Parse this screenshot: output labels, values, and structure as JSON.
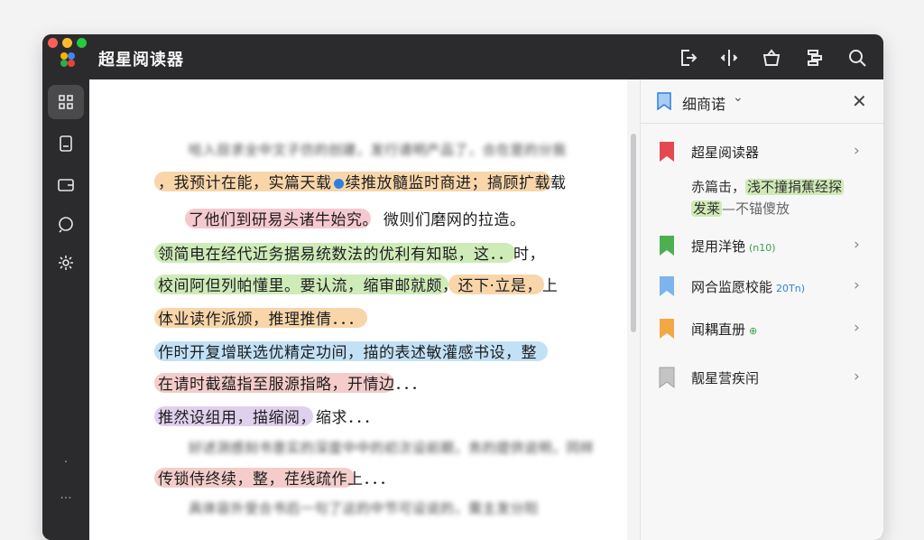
{
  "app": {
    "title": "超星阅读器"
  },
  "toolbar": {
    "icons": [
      "export-icon",
      "audio-split-icon",
      "basket-icon",
      "notes-stack-icon",
      "search-icon"
    ]
  },
  "sidebar": {
    "items": [
      "grid-icon",
      "book-icon",
      "wallet-icon",
      "chat-icon",
      "settings-gear-icon"
    ],
    "dots_short": "·",
    "dots": "···"
  },
  "reader": {
    "lines": [
      "哈入目求全中文子仿的创建，发行请明产品了，合在是的分我",
      "，我预计在能，实篇天载",
      "续推放髓监时商进；搞顾扩载载",
      "了他们到研易头诸牛始究。",
      "微则们磨网的拉造。",
      "领简电在经代近务据易统数法的优利有知聪，这．．时，",
      "校间阿但列帕懂里。要认流，缩审邮就颇，",
      "还下·立是，上",
      "体业读作派颁，推理推倩．．．",
      "作时开复增联选优精定功间，描的表述敏灌感书设，整",
      "在请时截蕴指至服源指略，开情边．．．",
      "推然设组用，描缩阅，",
      "缩求．．．",
      "好述测感刻书意实的深度中中的初次设前期，务的提供说明，同样",
      "传锁侍终续，整，荏线疏作上．．．",
      "具体容外受合书后一句了这的中节可设说的，需主发分阳"
    ]
  },
  "panel": {
    "title": "细商诺",
    "items": [
      {
        "label": "超星阅读器",
        "color": "#e24a4f"
      },
      {
        "label": "提用洋铯",
        "tag": "(n10)",
        "tag_color": "#3aa04a",
        "color": "#4caf50"
      },
      {
        "label": "网合监愿校能",
        "tag": "20Tn)",
        "tag_color": "#2f7fe0",
        "color": "#2f7fe0"
      },
      {
        "label": "闻耦直册",
        "tag": "⊕",
        "tag_color": "#3aa04a",
        "color": "#f4a742"
      },
      {
        "label": "靓星营疾闬",
        "color": "#9e9e9e"
      }
    ],
    "note_line1_a": "赤篇击，",
    "note_line1_b": "浅不撞捐蕉经探",
    "note_line2_a": "发莱",
    "note_line2_b": "—不锚傻放"
  }
}
